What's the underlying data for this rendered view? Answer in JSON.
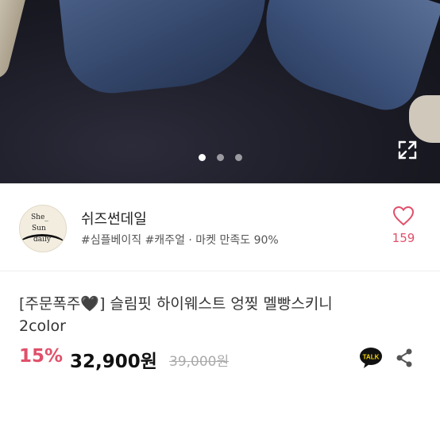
{
  "carousel": {
    "total_slides": 3,
    "active_slide": 1,
    "dot_active_color": "#ffffff",
    "dot_inactive_color": "#9a9aa0",
    "expand_icon": "expand-icon"
  },
  "shop": {
    "avatar_lines": [
      "She_",
      "Sun",
      "daily"
    ],
    "name": "쉬즈썬데일",
    "tags": "#심플베이직 #캐주얼 · 마켓 만족도 90%",
    "likes": "159",
    "like_icon": "heart-icon",
    "accent_color": "#e0506a"
  },
  "product": {
    "title_prefix": "[주문폭주",
    "title_emoji": "🖤",
    "title_suffix": "] 슬림핏 하이웨스트 엉찢 멜빵스키니",
    "title_line2": "2color",
    "discount": "15%",
    "price": "32,900원",
    "original_price": "39,000원",
    "talk_label": "TALK",
    "share_icon": "share-icon"
  }
}
